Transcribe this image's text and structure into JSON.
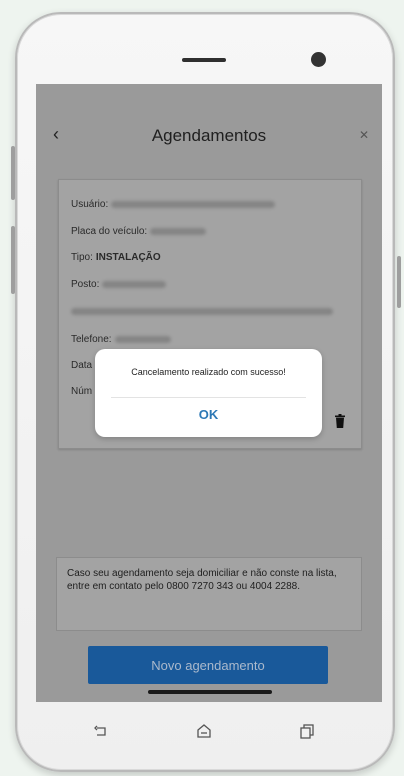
{
  "header": {
    "title": "Agendamentos",
    "back_icon": "arrow-left",
    "close_icon": "close-x"
  },
  "appointment": {
    "usuario_label": "Usuário:",
    "placa_label": "Placa do veículo:",
    "tipo_label": "Tipo:",
    "tipo_value": "INSTALAÇÃO",
    "posto_label": "Posto:",
    "telefone_label": "Telefone:",
    "data_label": "Data",
    "numero_label": "Núm",
    "delete_icon": "trash-icon"
  },
  "dialog": {
    "message": "Cancelamento realizado com sucesso!",
    "ok_label": "OK"
  },
  "info": {
    "text": "Caso seu agendamento seja domiciliar e não conste na lista, entre em contato pelo 0800 7270 343 ou 4004 2288."
  },
  "actions": {
    "new_appointment_label": "Novo agendamento"
  },
  "colors": {
    "overlay_gray": "#9a9a9a",
    "primary_button": "#19599a",
    "dialog_ok": "#2d78b5"
  },
  "system_nav": {
    "back_icon": "back-icon",
    "home_icon": "home-icon",
    "recents_icon": "recents-icon"
  }
}
